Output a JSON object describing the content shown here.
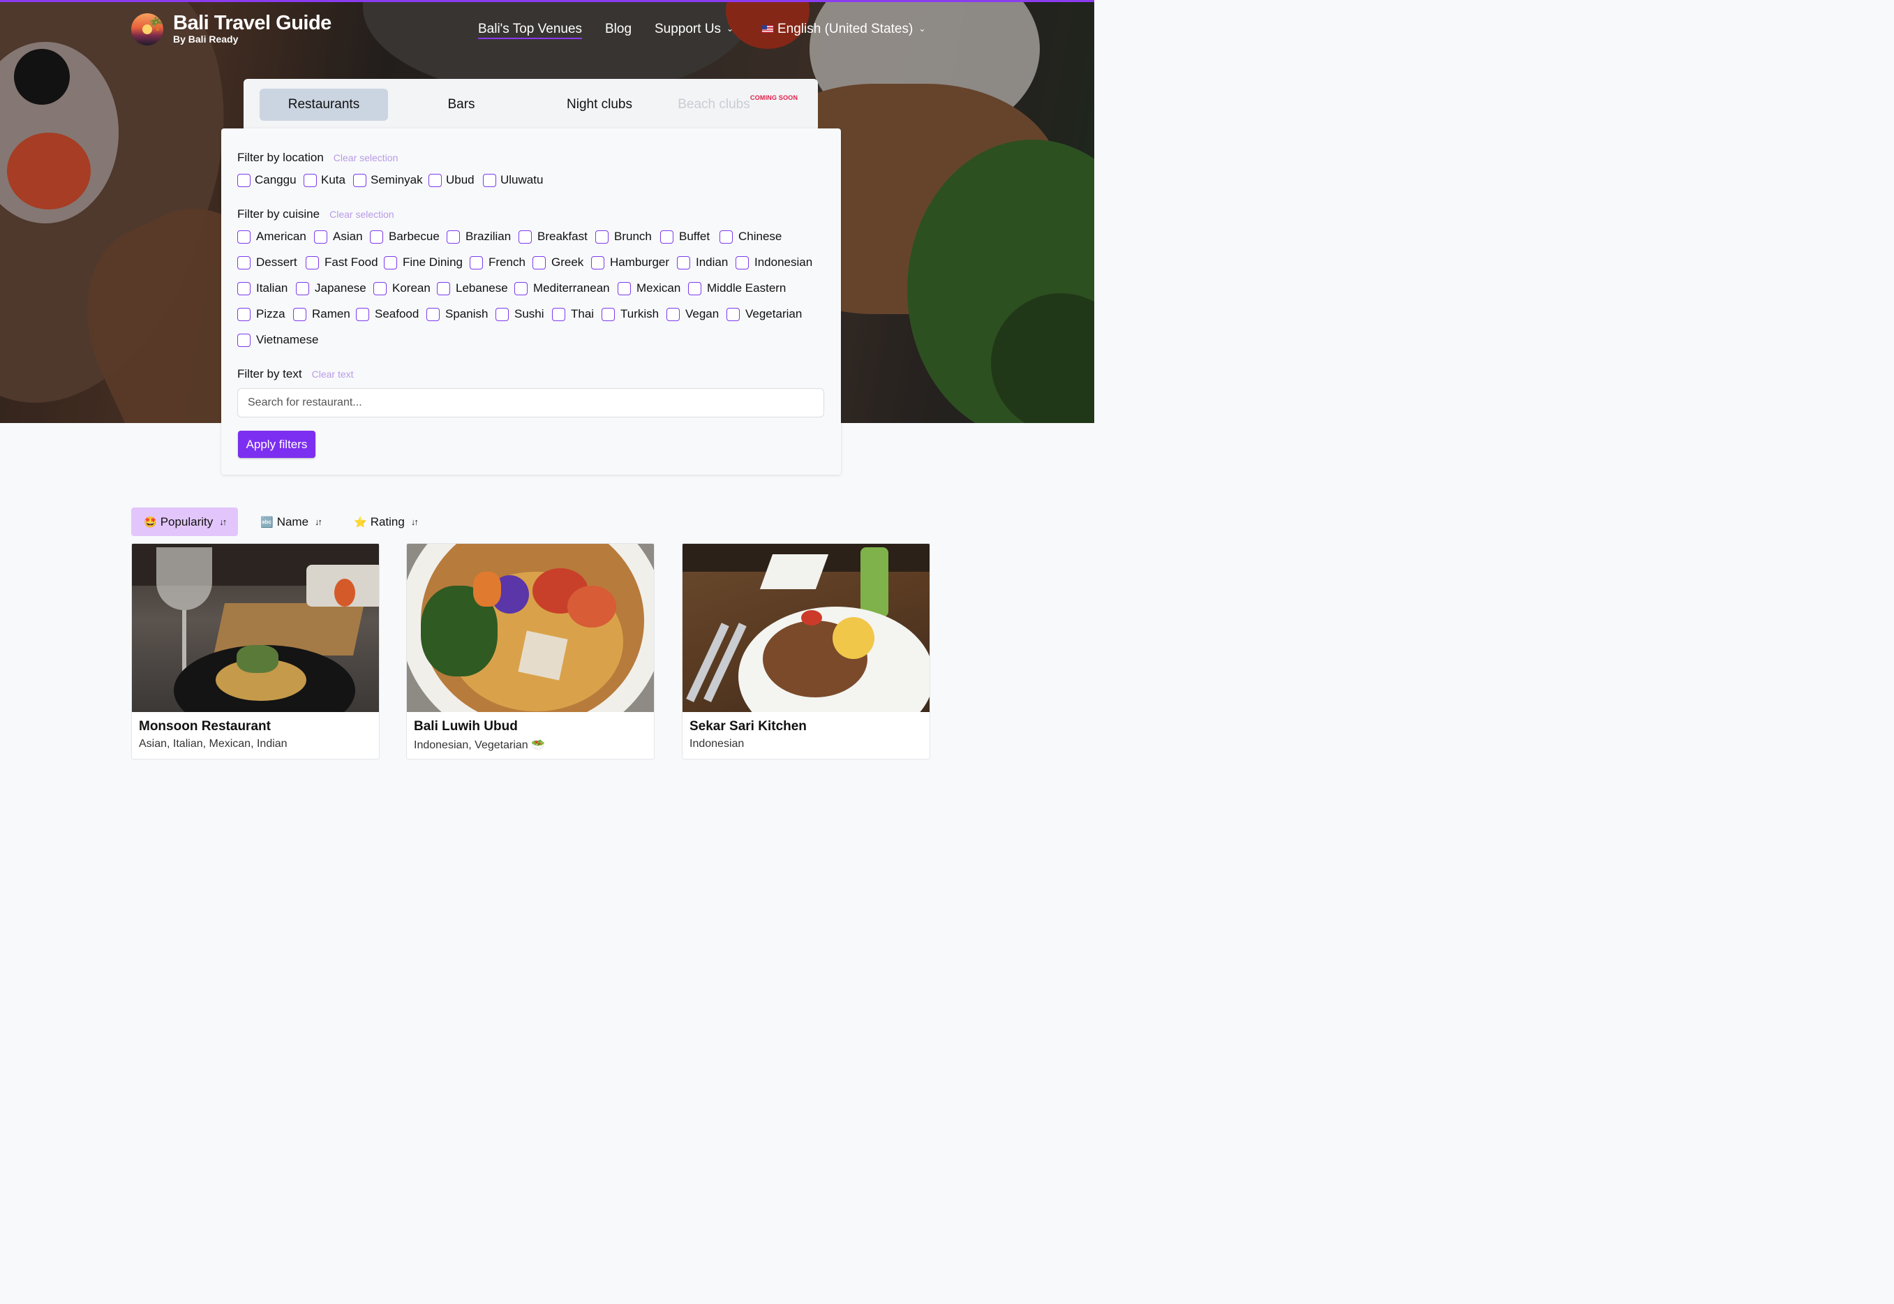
{
  "site": {
    "title": "Bali Travel Guide",
    "subtitle": "By Bali Ready"
  },
  "nav": {
    "links": [
      {
        "label": "Bali's Top Venues",
        "active": true
      },
      {
        "label": "Blog"
      },
      {
        "label": "Support Us",
        "dropdown": true
      }
    ],
    "language": "English (United States)"
  },
  "tabs": [
    {
      "label": "Restaurants",
      "active": true
    },
    {
      "label": "Bars"
    },
    {
      "label": "Night clubs"
    },
    {
      "label": "Beach clubs",
      "disabled": true,
      "badge": "COMING SOON"
    }
  ],
  "filters": {
    "location": {
      "label": "Filter by location",
      "clear": "Clear selection",
      "options": [
        "Canggu",
        "Kuta",
        "Seminyak",
        "Ubud",
        "Uluwatu"
      ]
    },
    "cuisine": {
      "label": "Filter by cuisine",
      "clear": "Clear selection",
      "rows": [
        [
          "American",
          "Asian",
          "Barbecue",
          "Brazilian",
          "Breakfast",
          "Brunch",
          "Buffet",
          "Chinese"
        ],
        [
          "Dessert",
          "Fast Food",
          "Fine Dining",
          "French",
          "Greek",
          "Hamburger",
          "Indian",
          "Indonesian"
        ],
        [
          "Italian",
          "Japanese",
          "Korean",
          "Lebanese",
          "Mediterranean",
          "Mexican",
          "Middle Eastern"
        ],
        [
          "Pizza",
          "Ramen",
          "Seafood",
          "Spanish",
          "Sushi",
          "Thai",
          "Turkish",
          "Vegan",
          "Vegetarian"
        ],
        [
          "Vietnamese"
        ]
      ]
    },
    "text": {
      "label": "Filter by text",
      "clear": "Clear text",
      "placeholder": "Search for restaurant..."
    },
    "apply": "Apply filters"
  },
  "sort": [
    {
      "emoji": "🤩",
      "label": "Popularity",
      "active": true
    },
    {
      "emoji": "🔤",
      "label": "Name"
    },
    {
      "emoji": "⭐",
      "label": "Rating"
    }
  ],
  "venues": [
    {
      "name": "Monsoon Restaurant",
      "cuisines": "Asian, Italian, Mexican, Indian"
    },
    {
      "name": "Bali Luwih Ubud",
      "cuisines": "Indonesian, Vegetarian 🥗"
    },
    {
      "name": "Sekar Sari Kitchen",
      "cuisines": "Indonesian"
    }
  ],
  "colors": {
    "accent": "#7c2ff0",
    "accent_light": "#e2c6fb",
    "tab_active": "#cbd5e1",
    "coming_soon": "#e11d48"
  }
}
